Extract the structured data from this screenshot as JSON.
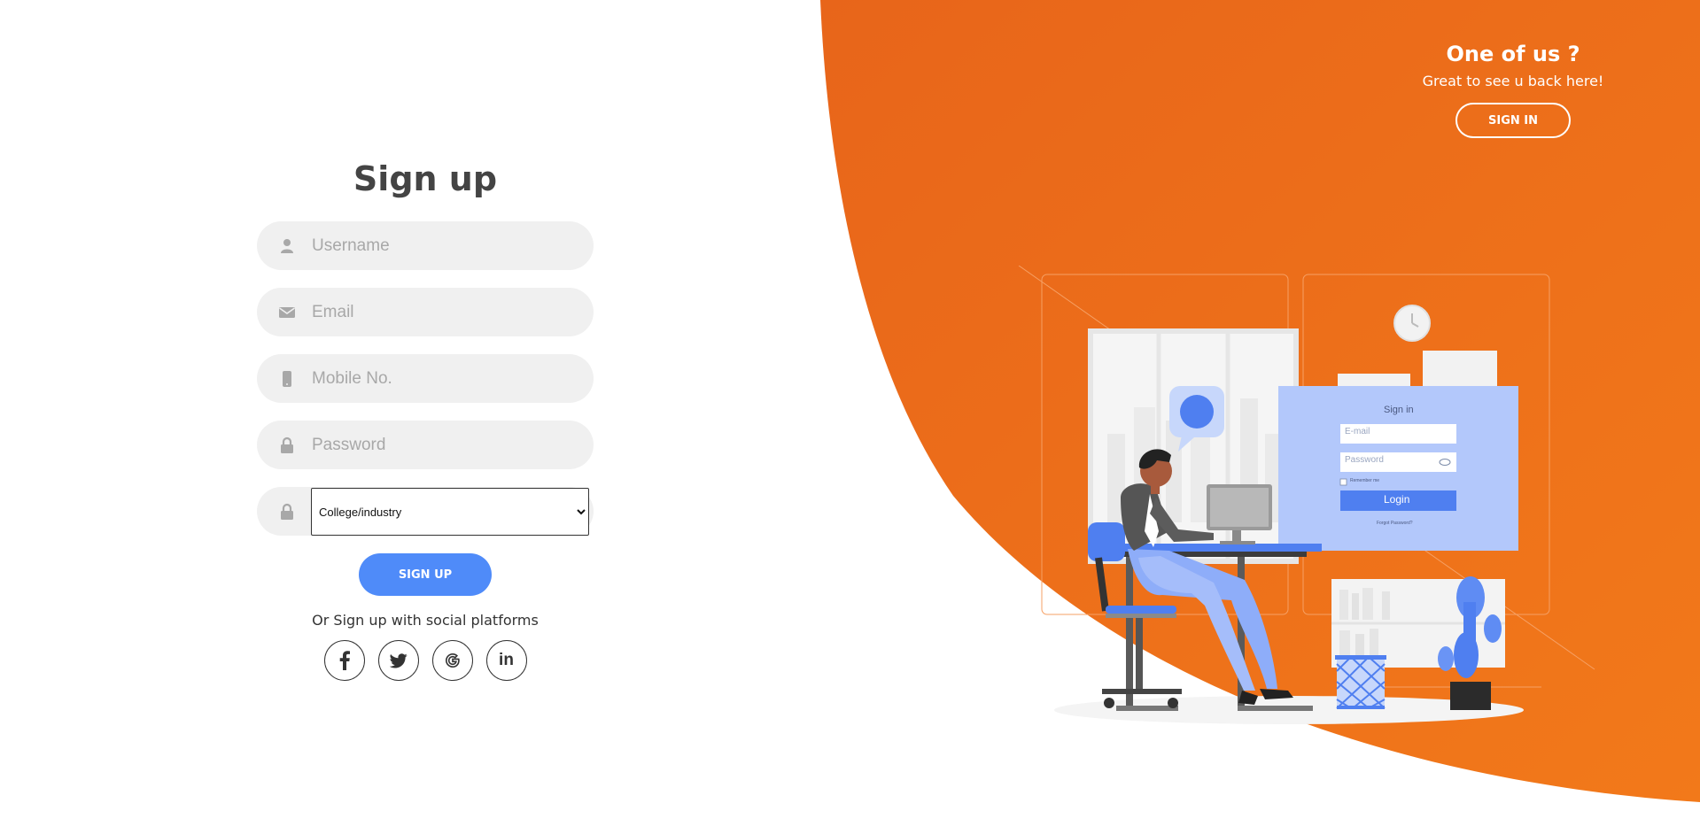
{
  "form": {
    "title": "Sign up",
    "username_placeholder": "Username",
    "email_placeholder": "Email",
    "mobile_placeholder": "Mobile No.",
    "password_placeholder": "Password",
    "category_selected": "College/industry",
    "submit_label": "SIGN UP",
    "social_text": "Or Sign up with social platforms",
    "social": {
      "facebook_icon": "facebook-icon",
      "twitter_icon": "twitter-icon",
      "google_icon": "google-icon",
      "linkedin_label": "in"
    },
    "icons": {
      "username": "user-icon",
      "email": "envelope-icon",
      "mobile": "mobile-phone-icon",
      "password": "lock-icon",
      "category": "lock-icon"
    }
  },
  "panel": {
    "title": "One of us ?",
    "subtitle": "Great to see u back here!",
    "signin_label": "SIGN IN"
  },
  "illustration": {
    "screen_title": "Sign in",
    "email_placeholder": "E-mail",
    "password_placeholder": "Password",
    "remember_label": "Remember me",
    "login_label": "Login",
    "forgot_label": "Forgot Password?"
  },
  "colors": {
    "accent_orange": "#ec6a15",
    "primary_blue": "#4f8bf9",
    "field_bg": "#f0f0f0",
    "text_dark": "#444444"
  }
}
